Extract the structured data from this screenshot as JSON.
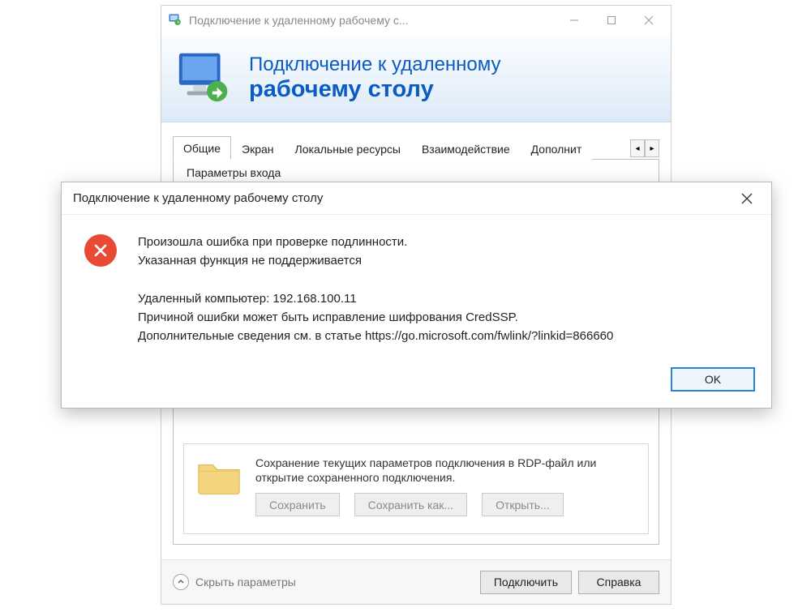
{
  "main": {
    "title": "Подключение к удаленному рабочему с...",
    "banner": {
      "line1": "Подключение к удаленному",
      "line2": "рабочему столу"
    },
    "tabs": {
      "items": [
        {
          "label": "Общие",
          "active": true
        },
        {
          "label": "Экран",
          "active": false
        },
        {
          "label": "Локальные ресурсы",
          "active": false
        },
        {
          "label": "Взаимодействие",
          "active": false
        },
        {
          "label": "Дополнит",
          "active": false
        }
      ],
      "scroll_left": "◂",
      "scroll_right": "▸"
    },
    "login_group_label": "Параметры входа",
    "saved": {
      "text": "Сохранение текущих параметров подключения в RDP-файл или открытие сохраненного подключения.",
      "save": "Сохранить",
      "save_as": "Сохранить как...",
      "open": "Открыть..."
    },
    "bottom": {
      "toggle": "Скрыть параметры",
      "connect": "Подключить",
      "help": "Справка"
    }
  },
  "error": {
    "title": "Подключение к удаленному рабочему столу",
    "line1": "Произошла ошибка при проверке подлинности.",
    "line2": "Указанная функция не поддерживается",
    "line3": "Удаленный компьютер: 192.168.100.11",
    "line4": "Причиной ошибки может быть исправление шифрования CredSSP.",
    "line5": "Дополнительные сведения см. в статье https://go.microsoft.com/fwlink/?linkid=866660",
    "ok": "OK"
  }
}
